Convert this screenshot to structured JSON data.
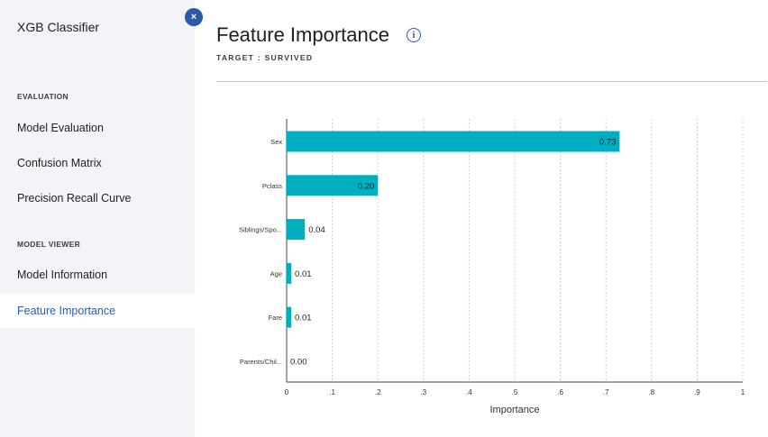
{
  "app": {
    "title": "XGB Classifier",
    "close_symbol": "×"
  },
  "sidebar": {
    "sections": [
      {
        "label": "EVALUATION",
        "items": [
          "Model Evaluation",
          "Confusion Matrix",
          "Precision Recall Curve"
        ]
      },
      {
        "label": "MODEL VIEWER",
        "items": [
          "Model Information",
          "Feature Importance"
        ]
      }
    ],
    "active_item": "Feature Importance"
  },
  "page": {
    "title": "Feature Importance",
    "info_symbol": "i",
    "target_text": "TARGET : SURVIVED"
  },
  "colors": {
    "bar": "#00aec1",
    "accent": "#2d5aa8",
    "sidebar_bg": "#f2f4f8"
  },
  "chart_data": {
    "type": "bar",
    "orientation": "horizontal",
    "categories": [
      "Sex",
      "Pclass",
      "Siblings/Spo...",
      "Age",
      "Fare",
      "Parents/Chil..."
    ],
    "values": [
      0.73,
      0.2,
      0.04,
      0.01,
      0.01,
      0.0
    ],
    "value_labels": [
      "0.73",
      "0.20",
      "0.04",
      "0.01",
      "0.01",
      "0.00"
    ],
    "xlabel": "Importance",
    "xlim": [
      0,
      1
    ],
    "ticks": [
      0,
      0.1,
      0.2,
      0.3,
      0.4,
      0.5,
      0.6,
      0.7,
      0.8,
      0.9,
      1
    ],
    "tick_labels": [
      "0",
      ".1",
      ".2",
      ".3",
      ".4",
      ".5",
      ".6",
      ".7",
      ".8",
      ".9",
      "1"
    ],
    "grid": true
  }
}
